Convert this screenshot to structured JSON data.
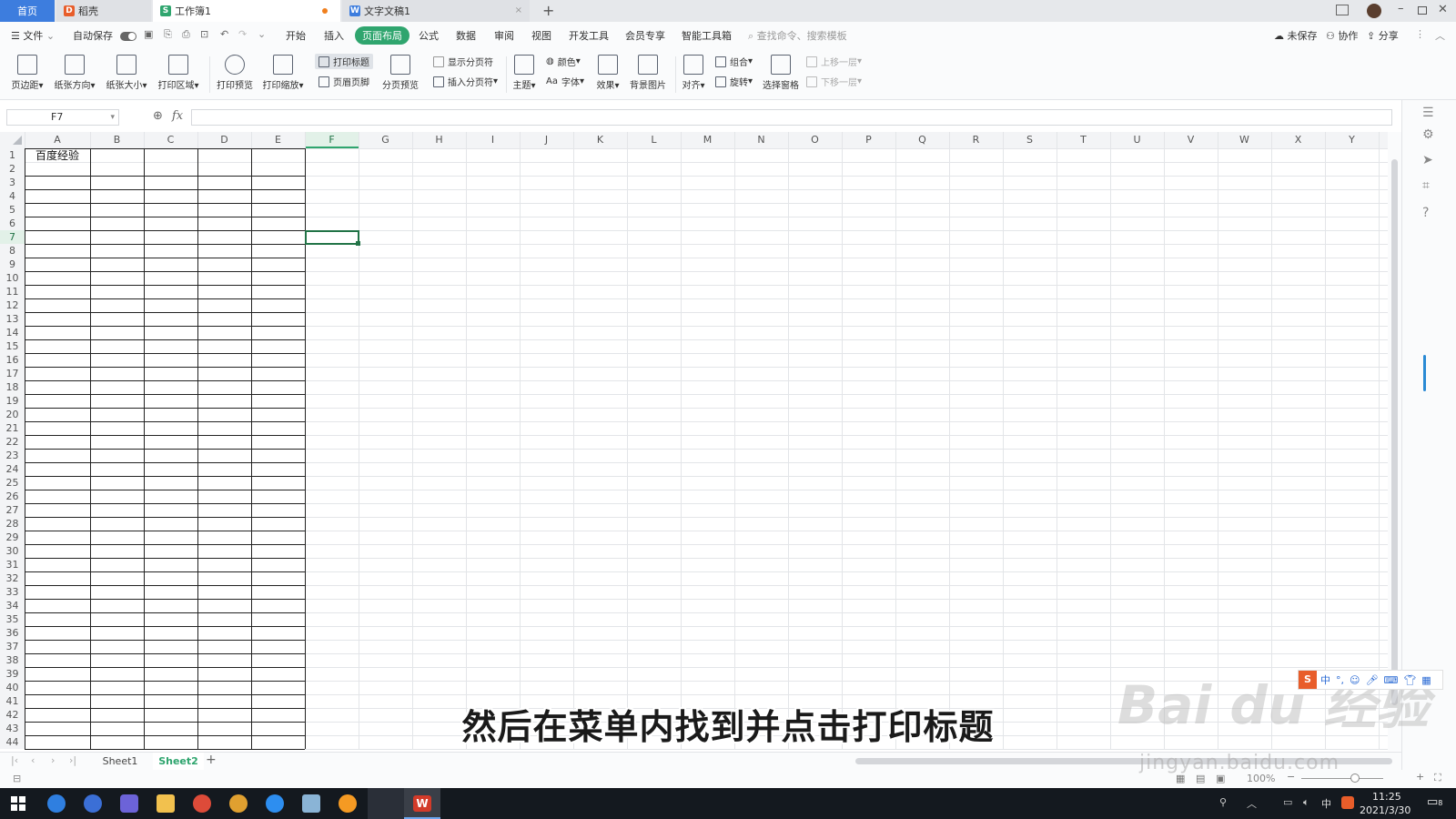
{
  "tabs": [
    {
      "label": "首页"
    },
    {
      "label": "稻壳",
      "icon": "docer-icon"
    },
    {
      "label": "工作簿1",
      "icon": "sheet-icon",
      "active": true
    },
    {
      "label": "文字文稿1",
      "icon": "word-icon"
    }
  ],
  "menu": {
    "file": "文件",
    "autosave": "自动保存",
    "items": [
      "开始",
      "插入",
      "页面布局",
      "公式",
      "数据",
      "审阅",
      "视图",
      "开发工具",
      "会员专享",
      "智能工具箱"
    ],
    "active": "页面布局",
    "search_placeholder": "查找命令、搜索模板",
    "unsaved": "未保存",
    "collab": "协作",
    "share": "分享"
  },
  "ribbon": {
    "margins": "页边距",
    "orientation": "纸张方向",
    "size": "纸张大小",
    "print_area": "打印区域",
    "print_preview": "打印预览",
    "print_scale": "打印缩放",
    "print_titles": "打印标题",
    "header_footer": "页眉页脚",
    "page_break_preview": "分页预览",
    "show_page_breaks": "显示分页符",
    "insert_page_break": "插入分页符",
    "theme": "主题",
    "colors": "颜色",
    "fonts": "字体",
    "font_prefix": "Aa",
    "effects": "效果",
    "background": "背景图片",
    "align": "对齐",
    "group": "组合",
    "rotate": "旋转",
    "selection_pane": "选择窗格",
    "bring_forward": "上移一层",
    "send_backward": "下移一层"
  },
  "formula": {
    "cell_ref": "F7",
    "fx": "fx",
    "value": ""
  },
  "sheet": {
    "columns": [
      "A",
      "B",
      "C",
      "D",
      "E",
      "F",
      "G",
      "H",
      "I",
      "J",
      "K",
      "L",
      "M",
      "N",
      "O",
      "P",
      "Q",
      "R",
      "S",
      "T",
      "U",
      "V",
      "W",
      "X",
      "Y"
    ],
    "active_column": "F",
    "active_row": 7,
    "rows": 44,
    "cells": [
      {
        "ref": "A1",
        "value": "百度经验"
      }
    ]
  },
  "sheet_tabs": [
    "Sheet1",
    "Sheet2"
  ],
  "active_sheet": "Sheet2",
  "status": {
    "zoom": "100%"
  },
  "subtitle": "然后在菜单内找到并点击打印标题",
  "watermark": {
    "logo": "Bai du 经验",
    "url": "jingyan.baidu.com"
  },
  "ime": {
    "lang": "中"
  },
  "taskbar": {
    "time": "11:25",
    "date": "2021/3/30",
    "lang": "中",
    "notify": "8"
  },
  "colors": {
    "accent": "#2fa56e",
    "selection": "#217346",
    "tab_home": "#3d7dde"
  }
}
